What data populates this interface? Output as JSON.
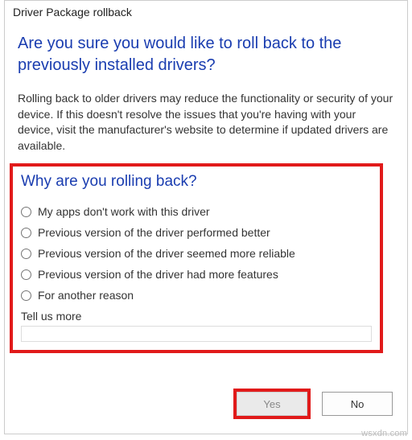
{
  "window": {
    "title": "Driver Package rollback"
  },
  "main": {
    "headline": "Are you sure you would like to roll back to the previously installed drivers?",
    "body": "Rolling back to older drivers may reduce the functionality or security of your device. If this doesn't resolve the issues that you're having with your device, visit the manufacturer's website to determine if updated drivers are available."
  },
  "reason": {
    "heading": "Why are you rolling back?",
    "options": [
      "My apps don't work with this driver",
      "Previous version of the driver performed better",
      "Previous version of the driver seemed more reliable",
      "Previous version of the driver had more features",
      "For another reason"
    ],
    "tell_more_label": "Tell us more",
    "tell_more_value": ""
  },
  "buttons": {
    "yes": "Yes",
    "no": "No"
  },
  "watermark": "wsxdn.com",
  "colors": {
    "link_blue": "#1a3db0",
    "highlight_red": "#e11a1a"
  }
}
